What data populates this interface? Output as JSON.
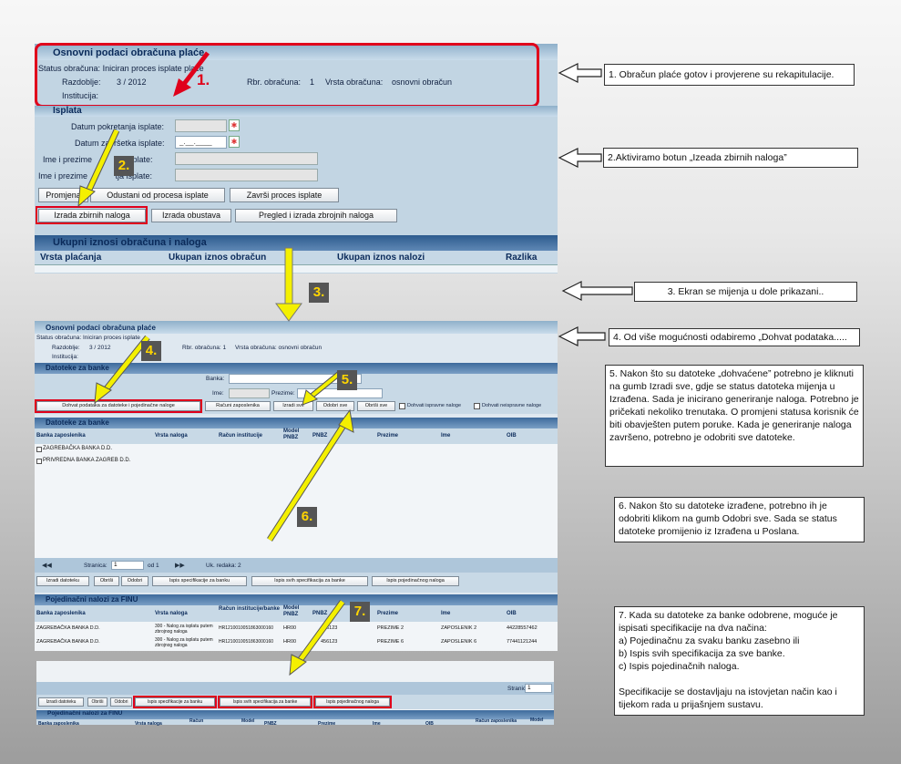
{
  "top": {
    "title": "Osnovni podaci obračuna plaće",
    "status_label": "Status obračuna:",
    "status_value": "Iniciran proces isplate plaće",
    "razdoblje_label": "Razdoblje:",
    "razdoblje_value": "3 / 2012",
    "rbr_label": "Rbr. obračuna:",
    "rbr_value": "1",
    "vrsta_label": "Vrsta obračuna:",
    "vrsta_value": "osnovni obračun",
    "institucija_label": "Institucija:"
  },
  "isplata": {
    "title": "Isplata",
    "datum_pokretanja": "Datum pokretanja isplate:",
    "datum_zavrsetka": "Datum završetka isplate:",
    "ime_prezime_1": "Ime i prezime",
    "ime_prezime_1_rest": "a isplate:",
    "ime_prezime_2": "Ime i prezime",
    "ime_prezime_2_rest": "tja isplate:",
    "date_mask": "_.__.____",
    "btn_promjena": "Promjena",
    "btn_odustani": "Odustani od procesa isplate",
    "btn_zavrsi": "Završi proces isplate",
    "btn_izrada_zbirnih": "Izrada zbirnih naloga",
    "btn_izrada_obustava": "Izrada obustava",
    "btn_pregled": "Pregled i izrada zbrojnih naloga"
  },
  "ukupni": {
    "title": "Ukupni iznosi obračuna i naloga",
    "cols": [
      "Vrsta plaćanja",
      "Ukupan iznos obračun",
      "Ukupan iznos nalozi",
      "Razlika"
    ]
  },
  "second": {
    "title": "Osnovni podaci obračuna plaće",
    "status": "Status obračuna: Iniciran proces isplate",
    "razdoblje_label": "Razdoblje:",
    "razdoblje_value": "3 / 2012",
    "rbr": "Rbr. obračuna: 1",
    "vrsta": "Vrsta obračuna: osnovni obračun",
    "institucija": "Institucija:",
    "datoteke_title": "Datoteke za banke",
    "banka_label": "Banka:",
    "ime_label": "Ime:",
    "prezime_label": "Prezime:",
    "btn_dohvat": "Dohvat podataka za datoteke i pojedinačne naloge",
    "btn_racuni": "Računi zaposlenika",
    "btn_izradi_sve": "Izradi sve",
    "btn_odobri_sve": "Odobri sve",
    "btn_obrisi_sve": "Obriši sve",
    "chk_ispravne": "Dohvati ispravne naloge",
    "chk_neispravne": "Dohvati neispravne naloge"
  },
  "dat_table": {
    "title": "Datoteke za banke",
    "cols": [
      "Banka zaposlenika",
      "Vrsta naloga",
      "Račun institucije",
      "Model PNBZ",
      "PNBZ",
      "Prezime",
      "Ime",
      "OIB"
    ],
    "rows": [
      "ZAGREBAČKA BANKA D.D.",
      "PRIVREDNA BANKA ZAGREB D.D."
    ],
    "pager_stranica": "Stranica:",
    "pager_value": "1",
    "pager_od": "od 1",
    "pager_uk": "Uk. redaka: 2",
    "btn_izradi": "Izradi datoteku",
    "btn_obrisi": "Obriši",
    "btn_odobri": "Odobri",
    "btn_ispis_spec": "Ispis specifikacije za banku",
    "btn_ispis_svih": "Ispis svih specifikacija za banke",
    "btn_ispis_poj": "Ispis pojedinačnog naloga"
  },
  "finu": {
    "title": "Pojedinačni nalozi za FINU",
    "cols": [
      "Banka zaposlenika",
      "Vrsta naloga",
      "Račun institucije/banke",
      "Model PNBZ",
      "PNBZ",
      "Prezime",
      "Ime",
      "OIB"
    ],
    "rows": [
      {
        "banka": "ZAGREBAČKA BANKA D.D.",
        "vrsta": "300 - Nalog za isplatu putem zbrojnog naloga",
        "racun": "HR1210010051863000160",
        "model": "HR00",
        "pnbz": "456123",
        "prezime": "PREZIME 2",
        "ime": "ZAPOSLENIK 2",
        "oib": "44228557462"
      },
      {
        "banka": "ZAGREBAČKA BANKA D.D.",
        "vrsta": "300 - Nalog za isplatu putem zbrojnog naloga",
        "racun": "HR1210010051863000160",
        "model": "HR00",
        "pnbz": "456123",
        "prezime": "PREZIME 6",
        "ime": "ZAPOSLENIK 6",
        "oib": "77441121244"
      }
    ]
  },
  "bottom": {
    "stranica": "Stranic",
    "stranica_value": "1",
    "btn_izradi": "Izradi datoteku",
    "btn_obrisi": "Obriši",
    "btn_odobri": "Odobri",
    "btn_ispis_spec": "Ispis specifikacije za banku",
    "btn_ispis_svih": "Ispis svih specifikacija za banke",
    "btn_ispis_poj": "Ispis pojedinačnog naloga",
    "finu_title": "Pojedinačni nalozi za FINU",
    "cols": [
      "Banka zaposlenika",
      "Vrsta naloga",
      "Račun",
      "Model",
      "PNBZ",
      "Prezime",
      "Ime",
      "OIB",
      "Račun zaposlenika",
      "Model"
    ]
  },
  "steps": {
    "n1": "1.",
    "n2": "2.",
    "n3": "3.",
    "n4": "4.",
    "n5": "5.",
    "n6": "6.",
    "n7": "7."
  },
  "notes": {
    "note1": "1. Obračun plaće gotov i provjerene su rekapitulacije.",
    "note2": "2.Aktiviramo botun „Izeada zbirnih naloga”",
    "note3": "3. Ekran se mijenja u dole prikazani..",
    "note4": "4. Od više mogućnosti odabiremo „Dohvat podataka.....",
    "note5": "5.  Nakon što su datoteke „dohvaćene” potrebno je kliknuti na gumb Izradi sve, gdje se status datoteka mijenja u Izrađena. Sada je inicirano generiranje naloga. Potrebno je pričekati nekoliko trenutaka. O promjeni statusa korisnik će biti obavješten putem poruke. Kada je generiranje naloga završeno, potrebno je odobriti sve datoteke.",
    "note6": "6. Nakon što su datoteke izrađene, potrebno ih je odobriti klikom na gumb Odobri sve. Sada se status datoteke promijenio iz Izrađena u Poslana.",
    "note7_1": "7. Kada su datoteke za banke odobrene, moguće je ispisati specifikacije na dva načina:",
    "note7_a": "a) Pojedinačnu za svaku banku zasebno ili",
    "note7_b": "b) Ispis svih specifikacija za sve banke.",
    "note7_c": "c) Ispis pojedinačnih naloga.",
    "note7_2": "Specifikacije se dostavljaju na istovjetan način kao i tijekom rada u prijašnjem sustavu."
  }
}
